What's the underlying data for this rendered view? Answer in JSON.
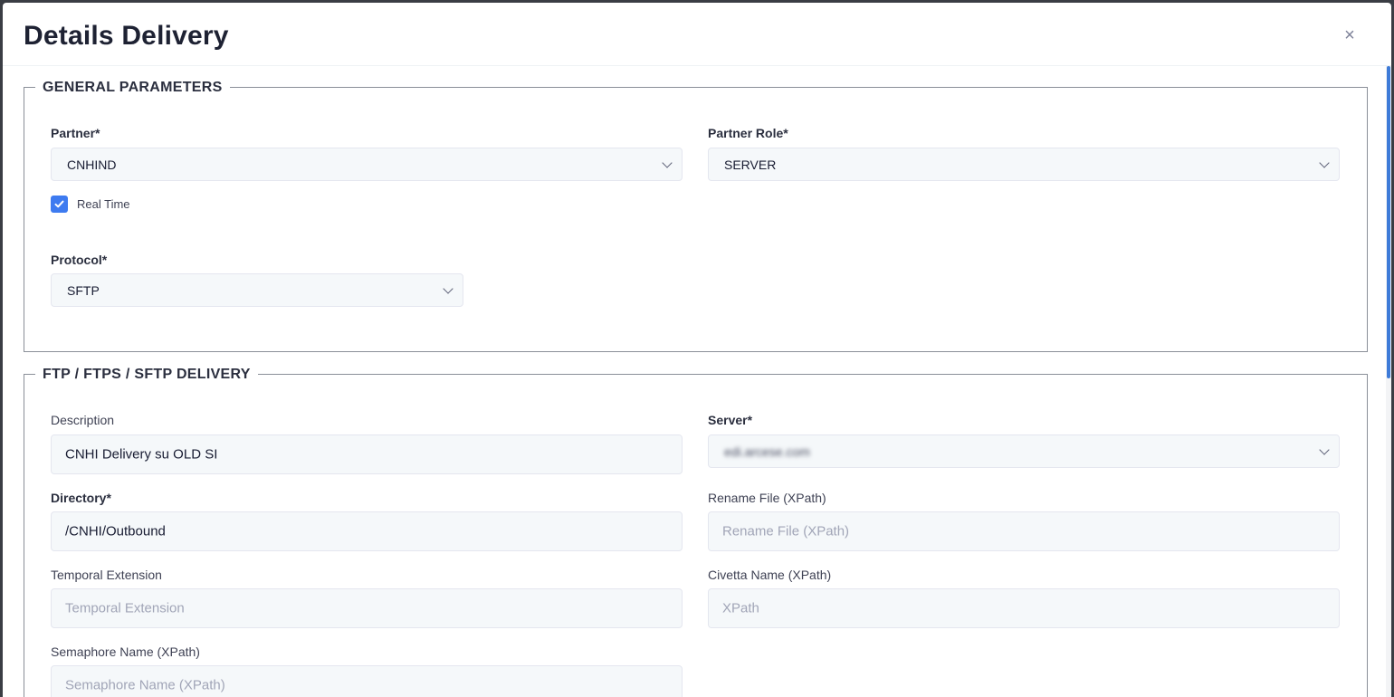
{
  "modal": {
    "title": "Details Delivery",
    "close_icon": "×"
  },
  "general": {
    "legend": "GENERAL PARAMETERS",
    "partner_label": "Partner*",
    "partner_value": "CNHIND",
    "partner_role_label": "Partner Role*",
    "partner_role_value": "SERVER",
    "real_time_label": "Real Time",
    "real_time_checked": true,
    "protocol_label": "Protocol*",
    "protocol_value": "SFTP"
  },
  "ftp": {
    "legend": "FTP / FTPS / SFTP DELIVERY",
    "description_label": "Description",
    "description_value": "CNHI Delivery su OLD SI",
    "server_label": "Server*",
    "server_value": "edi.arcese.com",
    "directory_label": "Directory*",
    "directory_value": "/CNHI/Outbound",
    "rename_label": "Rename File (XPath)",
    "rename_placeholder": "Rename File (XPath)",
    "temporal_label": "Temporal Extension",
    "temporal_placeholder": "Temporal Extension",
    "civetta_label": "Civetta Name (XPath)",
    "civetta_placeholder": "XPath",
    "semaphore_label": "Semaphore Name (XPath)",
    "semaphore_placeholder": "Semaphore Name (XPath)"
  },
  "colors": {
    "accent": "#3e7bf0",
    "input_bg": "#f5f8fa"
  }
}
